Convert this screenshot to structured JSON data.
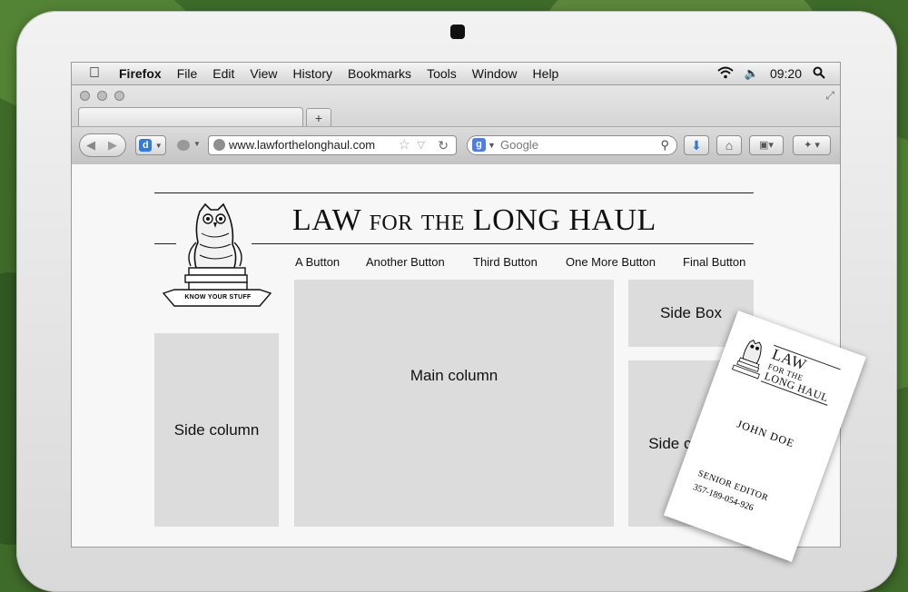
{
  "menubar": {
    "app_name": "Firefox",
    "menus": [
      "File",
      "Edit",
      "View",
      "History",
      "Bookmarks",
      "Tools",
      "Window",
      "Help"
    ],
    "clock": "09:20"
  },
  "browser": {
    "new_tab_symbol": "+",
    "url": "www.lawforthelonghaul.com",
    "search_placeholder": "Google",
    "search_engine_letter": "g"
  },
  "site": {
    "title": "LAW for the LONG HAUL",
    "logo_banner": "KNOW YOUR STUFF",
    "nav": [
      "A Button",
      "Another Button",
      "Third Button",
      "One More Button",
      "Final Button"
    ],
    "boxes": {
      "left_side": "Side column",
      "main": "Main column",
      "side_box": "Side Box",
      "right_side": "Side column"
    }
  },
  "business_card": {
    "title_lines": [
      "LAW",
      "FOR THE",
      "LONG HAUL"
    ],
    "name": "JOHN DOE",
    "role": "Senior Editor",
    "phone": "357-189-054-926"
  },
  "colors": {
    "placeholder_box": "#dcdcdc",
    "page_bg": "#f7f7f7",
    "foliage": "#3f6b2a"
  }
}
